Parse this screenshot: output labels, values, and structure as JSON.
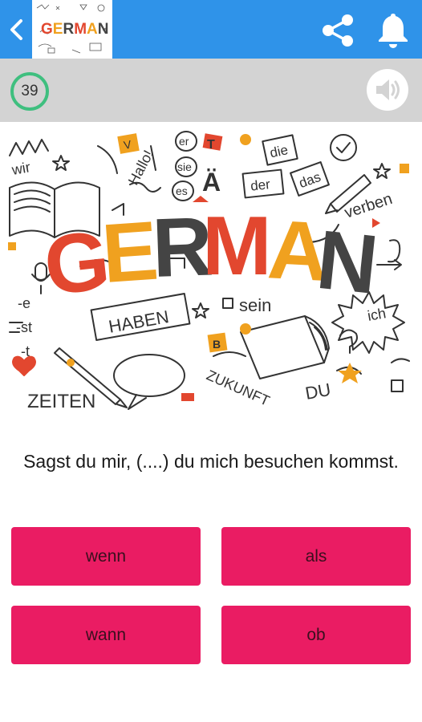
{
  "header": {
    "back_icon": "chevron-left-icon",
    "logo_text": "GERMAN",
    "share_icon": "share-icon",
    "bell_icon": "bell-icon"
  },
  "status": {
    "counter": "39",
    "sound_icon": "speaker-icon"
  },
  "illustration": {
    "title_letters": [
      "G",
      "E",
      "R",
      "M",
      "A",
      "N"
    ],
    "title_colors": [
      "#e2472f",
      "#f0a11f",
      "#444444",
      "#e2472f",
      "#f0a11f",
      "#444444"
    ],
    "words": {
      "wir": "wir",
      "hallo": "Hallo!",
      "er": "er",
      "sie": "sie",
      "es": "es",
      "a_umlaut": "Ä",
      "die": "die",
      "der": "der",
      "das": "das",
      "verben": "verben",
      "haben": "HABEN",
      "sein": "sein",
      "ich": "ich",
      "zeiten": "ZEITEN",
      "zukunft": "ZUKUNFT",
      "du": "DU",
      "suffix_e": "-e",
      "suffix_st": "-st",
      "suffix_t": "-t",
      "block_b": "B",
      "block_v": "V",
      "block_t": "T"
    }
  },
  "question": {
    "text": "Sagst du mir, (....) du mich besuchen kommst."
  },
  "answers": [
    "wenn",
    "als",
    "wann",
    "ob"
  ],
  "colors": {
    "appbar": "#2f93e9",
    "statusbar": "#d3d3d3",
    "answer_button": "#ea1c63",
    "counter_ring": "#3fbf7f"
  }
}
